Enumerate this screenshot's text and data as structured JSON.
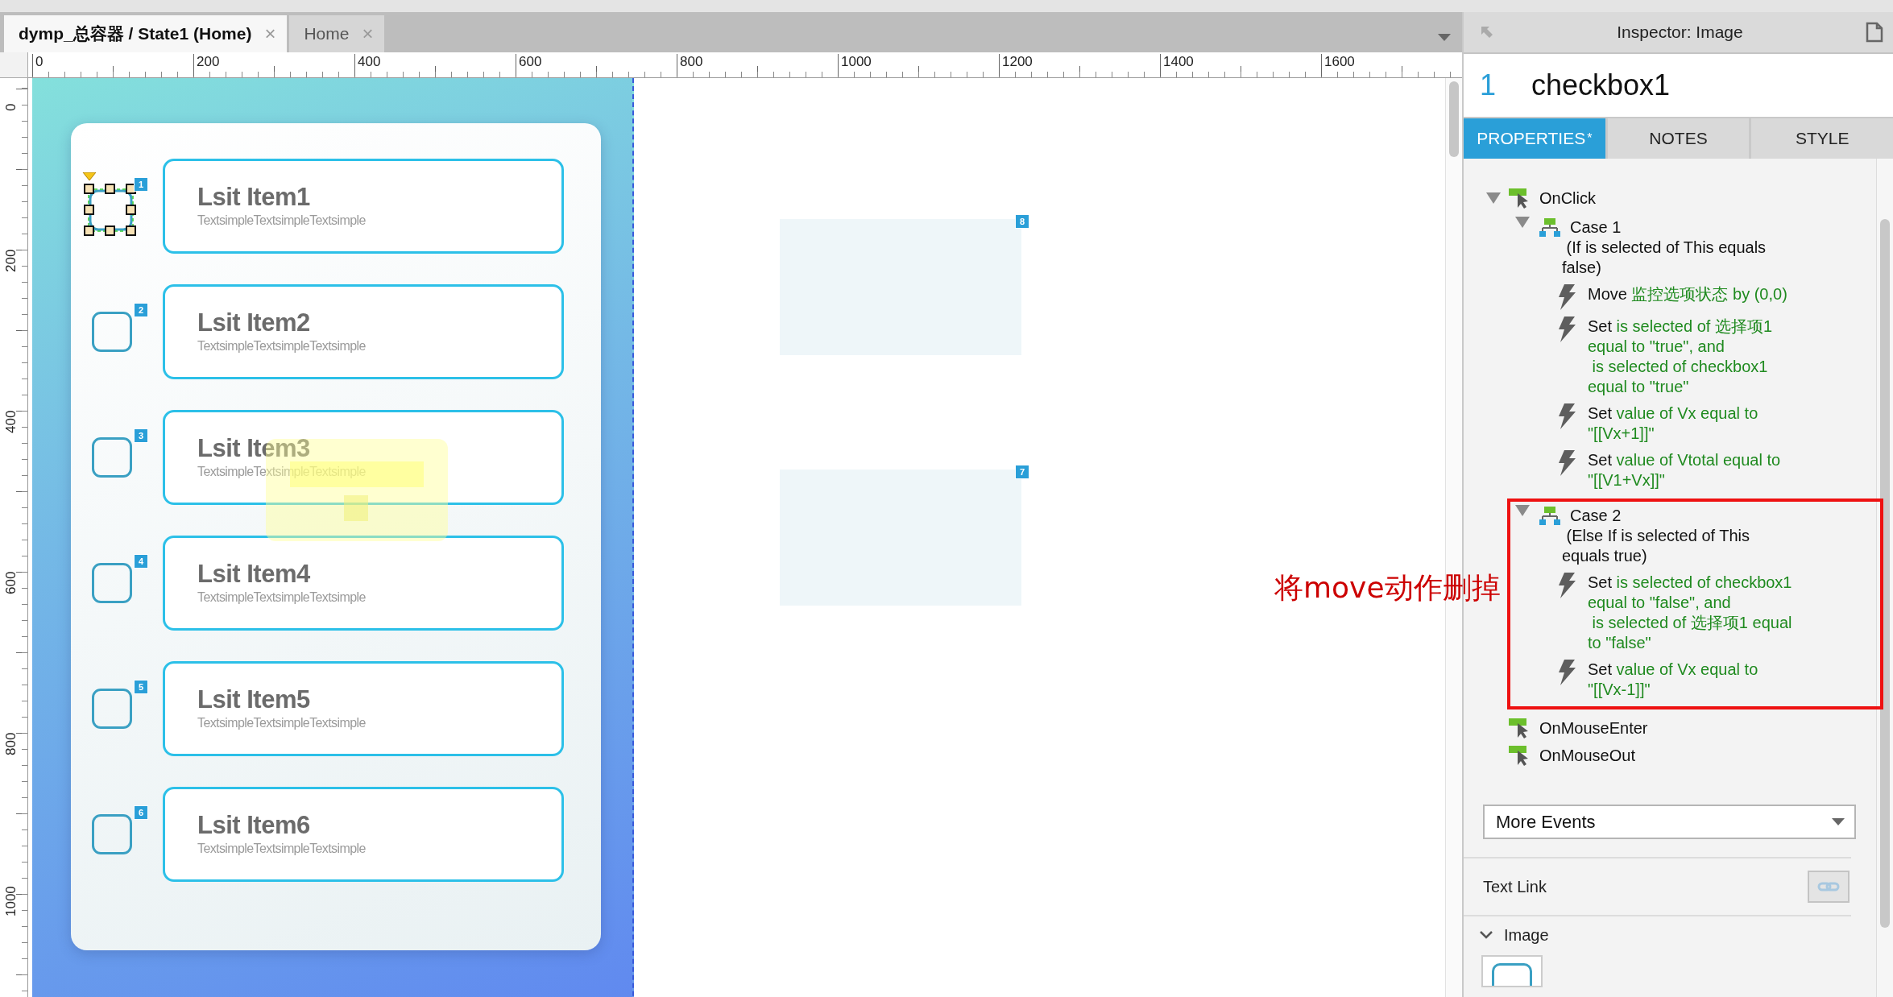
{
  "tabs": [
    {
      "label": "dymp_总容器 / State1 (Home)",
      "close": "×",
      "selected": true
    },
    {
      "label": "Home",
      "close": "×",
      "selected": false
    }
  ],
  "rulers": {
    "horizontal": [
      "0",
      "200",
      "400",
      "600",
      "800",
      "1000",
      "1200",
      "1400",
      "1600"
    ],
    "vertical": [
      "0",
      "200",
      "400",
      "600",
      "800",
      "1000"
    ]
  },
  "canvas": {
    "list_items": [
      {
        "title": "Lsit Item1",
        "subtitle": "TextsimpleTextsimpleTextsimple",
        "badge": "1",
        "selected": true
      },
      {
        "title": "Lsit Item2",
        "subtitle": "TextsimpleTextsimpleTextsimple",
        "badge": "2",
        "selected": false
      },
      {
        "title": "Lsit Item3",
        "subtitle": "TextsimpleTextsimpleTextsimple",
        "badge": "3",
        "selected": false
      },
      {
        "title": "Lsit Item4",
        "subtitle": "TextsimpleTextsimpleTextsimple",
        "badge": "4",
        "selected": false
      },
      {
        "title": "Lsit Item5",
        "subtitle": "TextsimpleTextsimpleTextsimple",
        "badge": "5",
        "selected": false
      },
      {
        "title": "Lsit Item6",
        "subtitle": "TextsimpleTextsimpleTextsimple",
        "badge": "6",
        "selected": false
      }
    ],
    "panels": [
      {
        "badge": "8"
      },
      {
        "badge": "7"
      }
    ]
  },
  "annotation": "将move动作删掉",
  "inspector": {
    "title": "Inspector: Image",
    "widget_number": "1",
    "widget_name": "checkbox1",
    "tabs": [
      {
        "label": "PROPERTIES",
        "marker": "*",
        "selected": true
      },
      {
        "label": "NOTES",
        "selected": false
      },
      {
        "label": "STYLE",
        "selected": false
      }
    ],
    "events": [
      {
        "name": "OnClick",
        "expanded": true,
        "cases": [
          {
            "title": "Case 1",
            "condition": "(If is selected of This equals\nfalse)",
            "expanded": true,
            "highlighted": false,
            "actions": [
              {
                "verb": "Move",
                "detail": "监控选项状态 by (0,0)"
              },
              {
                "verb": "Set",
                "detail": "is selected of 选择项1\nequal to \"true\", and\n is selected of checkbox1\nequal to \"true\""
              },
              {
                "verb": "Set",
                "detail": "value of Vx equal to\n\"[[Vx+1]]\""
              },
              {
                "verb": "Set",
                "detail": "value of Vtotal equal to\n\"[[V1+Vx]]\""
              }
            ]
          },
          {
            "title": "Case 2",
            "condition": "(Else If is selected of This\nequals true)",
            "expanded": true,
            "highlighted": true,
            "actions": [
              {
                "verb": "Set",
                "detail": "is selected of checkbox1\nequal to \"false\", and\n is selected of 选择项1 equal\nto \"false\""
              },
              {
                "verb": "Set",
                "detail": "value of Vx equal to\n\"[[Vx-1]]\""
              }
            ]
          }
        ]
      },
      {
        "name": "OnMouseEnter",
        "expanded": false
      },
      {
        "name": "OnMouseOut",
        "expanded": false
      }
    ],
    "more_events": "More Events",
    "text_link": "Text Link",
    "section": "Image",
    "section_expanded": true
  }
}
